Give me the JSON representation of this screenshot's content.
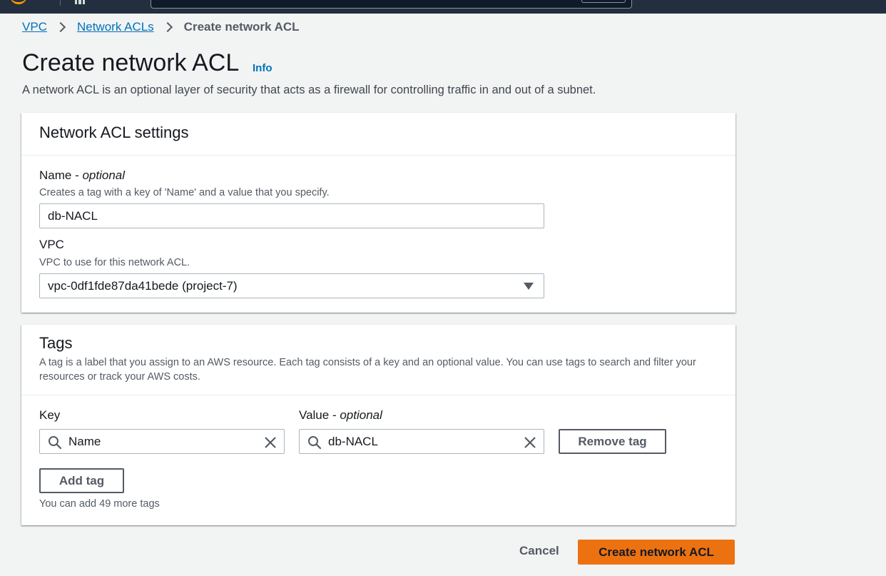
{
  "breadcrumb": {
    "items": [
      "VPC",
      "Network ACLs"
    ],
    "current": "Create network ACL"
  },
  "header": {
    "title": "Create network ACL",
    "info": "Info",
    "description": "A network ACL is an optional layer of security that acts as a firewall for controlling traffic in and out of a subnet."
  },
  "settings": {
    "title": "Network ACL settings",
    "name_label": "Name - ",
    "name_optional": "optional",
    "name_hint": "Creates a tag with a key of 'Name' and a value that you specify.",
    "name_value": "db-NACL",
    "vpc_label": "VPC",
    "vpc_hint": "VPC to use for this network ACL.",
    "vpc_value": "vpc-0df1fde87da41bede (project-7)"
  },
  "tags": {
    "title": "Tags",
    "description": "A tag is a label that you assign to an AWS resource. Each tag consists of a key and an optional value. You can use tags to search and filter your resources or track your AWS costs.",
    "key_label": "Key",
    "value_label": "Value - ",
    "value_optional": "optional",
    "key_value": "Name",
    "value_value": "db-NACL",
    "remove_label": "Remove tag",
    "add_label": "Add tag",
    "limit_text": "You can add 49 more tags"
  },
  "actions": {
    "cancel": "Cancel",
    "create": "Create network ACL"
  },
  "colors": {
    "link": "#0073bb",
    "primary": "#ec7211",
    "nav": "#232f3e",
    "brand": "#ff9900"
  },
  "icons": [
    "search-icon",
    "clear-icon",
    "caret-down-icon",
    "chevron-right-icon",
    "aws-logo-icon",
    "services-grid-icon"
  ]
}
